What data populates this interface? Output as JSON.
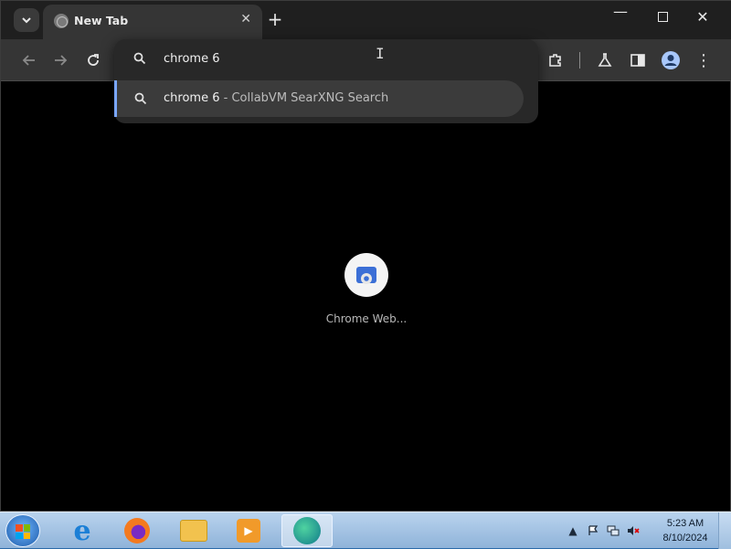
{
  "tab": {
    "title": "New Tab",
    "close_glyph": "✕",
    "favicon": "globe-icon"
  },
  "new_tab_glyph": "+",
  "window_controls": {
    "minimize": "—",
    "close": "✕"
  },
  "omnibox": {
    "query": "chrome 6",
    "suggestion": {
      "query": "chrome 6",
      "separator": "-",
      "description": "CollabVM SearXNG Search"
    }
  },
  "toolbar": {
    "menu_glyph": "⋮"
  },
  "shortcut": {
    "label": "Chrome Web..."
  },
  "taskbar": {
    "apps": [
      "Internet Explorer",
      "Firefox",
      "File Explorer",
      "Windows Media Player",
      "Microsoft Edge"
    ],
    "clock": {
      "time": "5:23 AM",
      "date": "8/10/2024"
    },
    "tray_arrow": "▲"
  },
  "colors": {
    "accent": "#7aa7ff",
    "tab_bg": "#353535",
    "page_bg": "#000000"
  }
}
